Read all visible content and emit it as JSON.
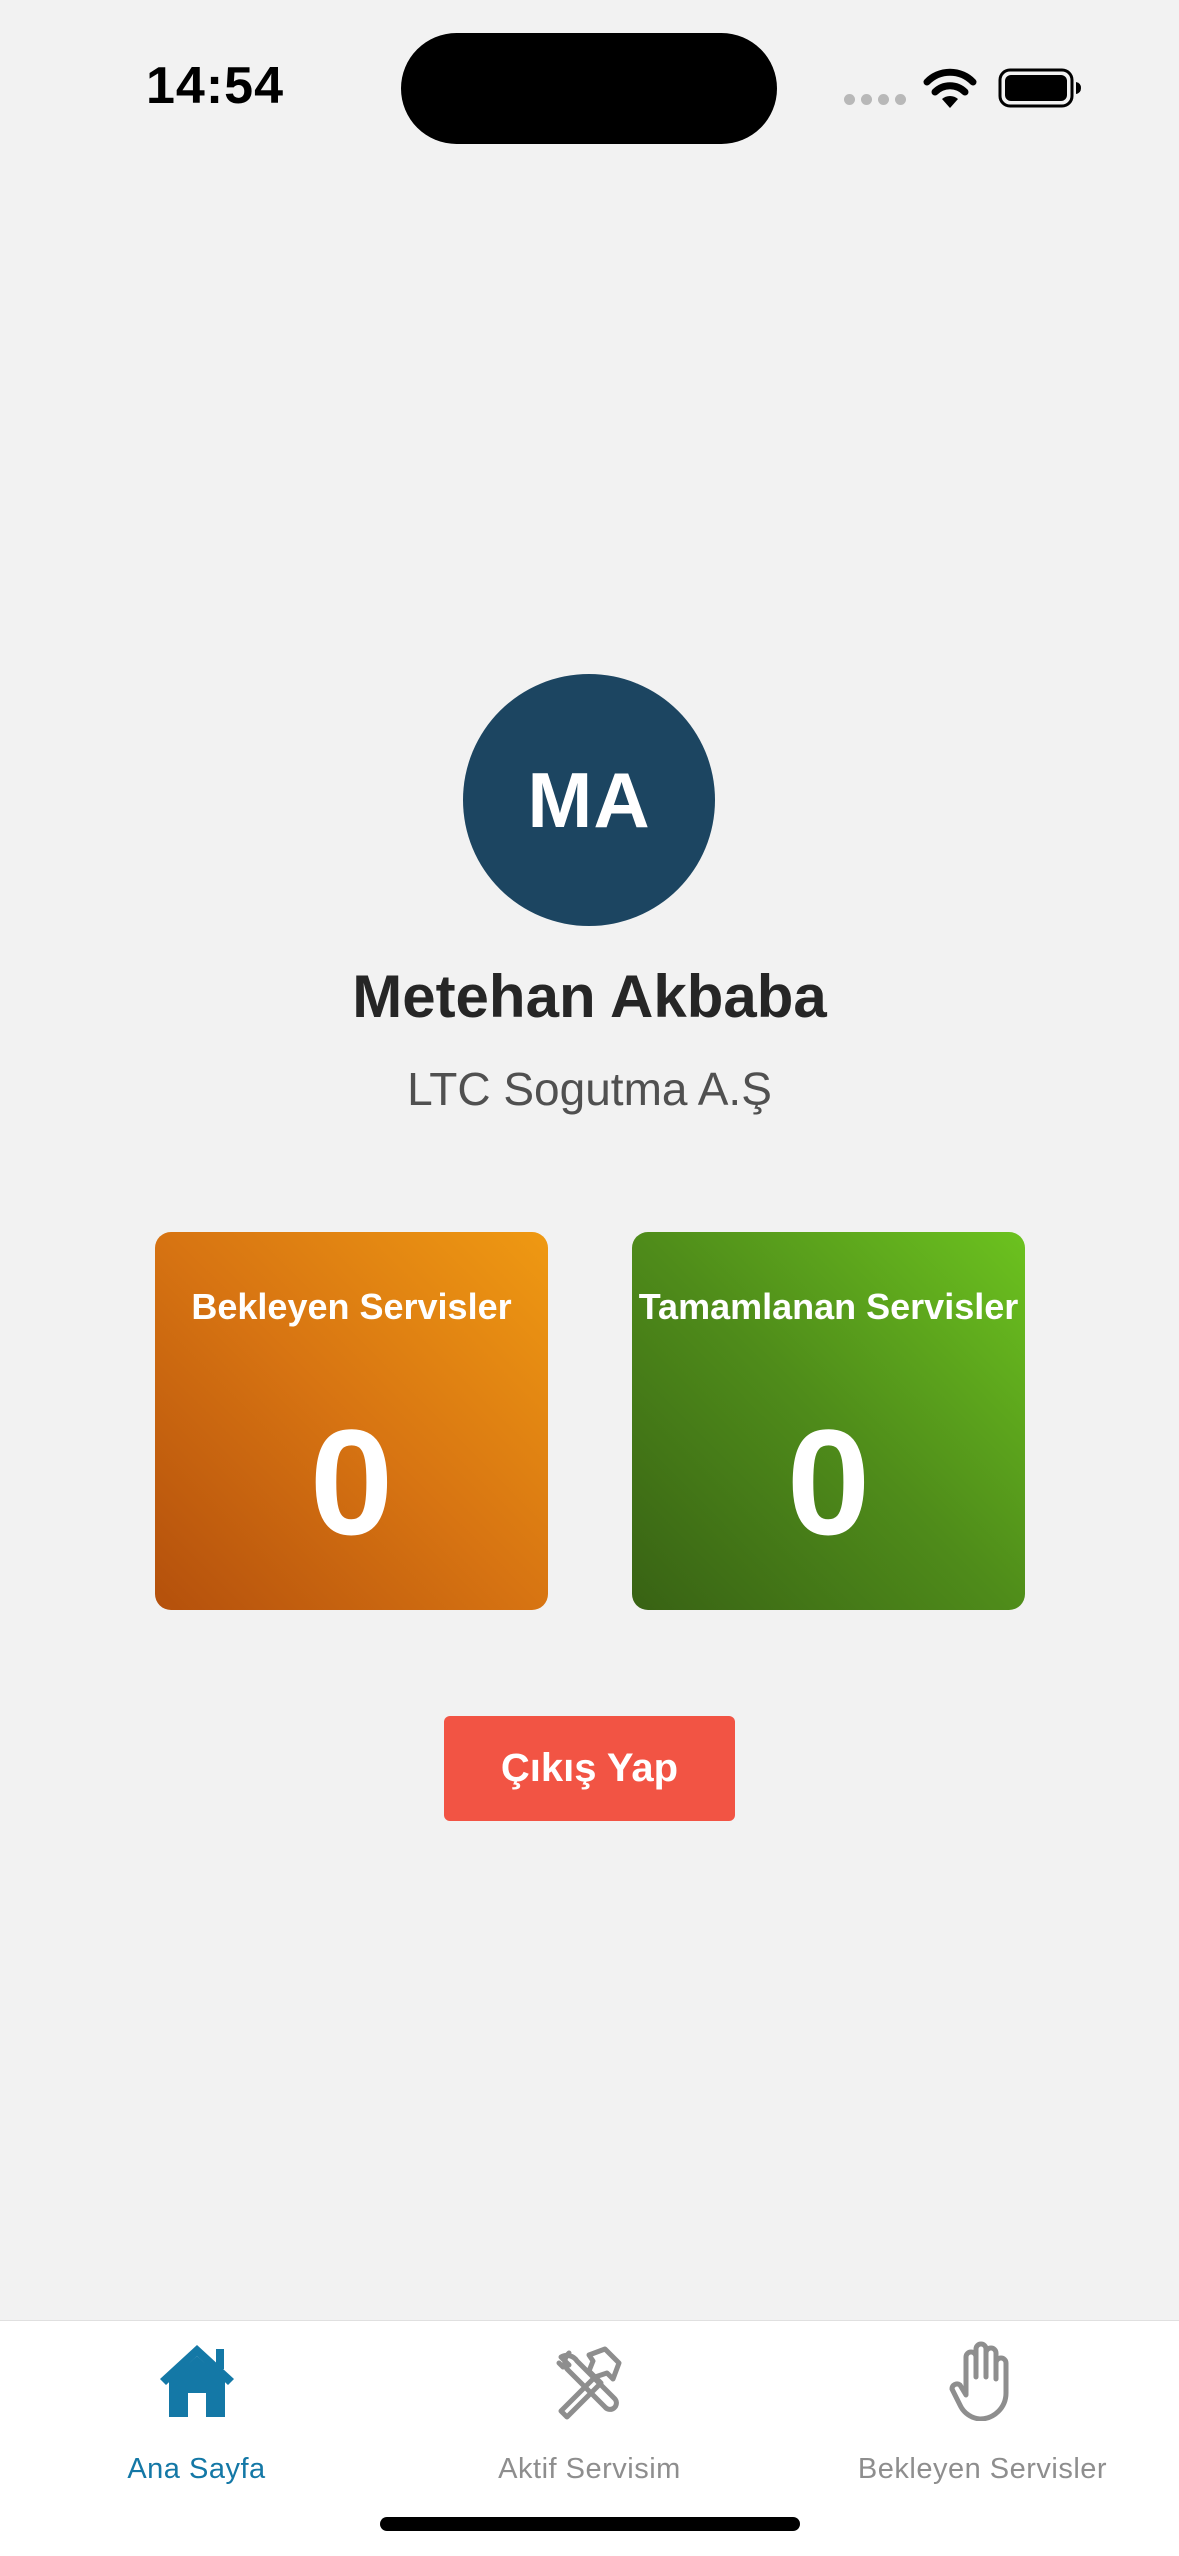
{
  "status_bar": {
    "time": "14:54",
    "signal_icon": "cellular-signal-icon",
    "wifi_icon": "wifi-icon",
    "battery_icon": "battery-icon"
  },
  "profile": {
    "initials": "MA",
    "name": "Metehan Akbaba",
    "company": "LTC Sogutma A.Ş",
    "avatar_color": "#1c4561"
  },
  "stats": {
    "pending": {
      "label": "Bekleyen Servisler",
      "value": "0",
      "color_start": "#b4500c",
      "color_end": "#ef9912"
    },
    "completed": {
      "label": "Tamamlanan Servisler",
      "value": "0",
      "color_start": "#386214",
      "color_end": "#6cc21f"
    }
  },
  "logout": {
    "label": "Çıkış Yap",
    "color": "#f25444"
  },
  "tab_bar": {
    "items": [
      {
        "label": "Ana Sayfa",
        "icon": "home-icon",
        "active": true
      },
      {
        "label": "Aktif Servisim",
        "icon": "tools-icon",
        "active": false
      },
      {
        "label": "Bekleyen Servisler",
        "icon": "hand-icon",
        "active": false
      }
    ],
    "active_color": "#1478a6",
    "inactive_color": "#8e8e8e"
  }
}
